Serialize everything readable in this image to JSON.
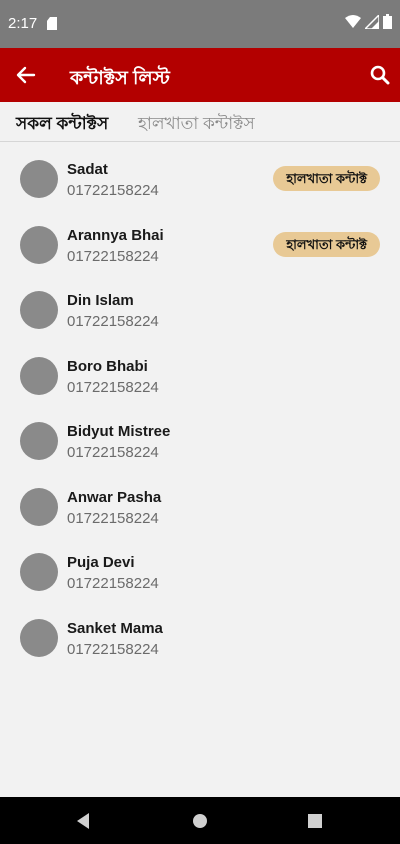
{
  "status_bar": {
    "time": "2:17"
  },
  "app_bar": {
    "title": "কন্টাক্টস লিস্ট"
  },
  "tabs": [
    {
      "label": "সকল কন্টাক্টস",
      "active": true
    },
    {
      "label": "হালখাতা কন্টাক্টস",
      "active": false
    }
  ],
  "contacts": [
    {
      "name": "Sadat",
      "phone": "01722158224",
      "badge": "হালখাতা কন্টাক্ট"
    },
    {
      "name": "Arannya Bhai",
      "phone": "01722158224",
      "badge": "হালখাতা কন্টাক্ট"
    },
    {
      "name": "Din Islam",
      "phone": "01722158224",
      "badge": ""
    },
    {
      "name": "Boro Bhabi",
      "phone": "01722158224",
      "badge": ""
    },
    {
      "name": "Bidyut Mistree",
      "phone": "01722158224",
      "badge": ""
    },
    {
      "name": "Anwar Pasha",
      "phone": "01722158224",
      "badge": ""
    },
    {
      "name": "Puja Devi",
      "phone": "01722158224",
      "badge": ""
    },
    {
      "name": "Sanket Mama",
      "phone": "01722158224",
      "badge": ""
    }
  ],
  "colors": {
    "app_bar": "#b30000",
    "badge": "#e8c995",
    "avatar": "#8a8a8a"
  },
  "icons": [
    "sd-card-icon",
    "wifi-icon",
    "signal-icon",
    "battery-icon",
    "back-arrow-icon",
    "search-icon",
    "nav-back-icon",
    "nav-home-icon",
    "nav-recents-icon"
  ]
}
